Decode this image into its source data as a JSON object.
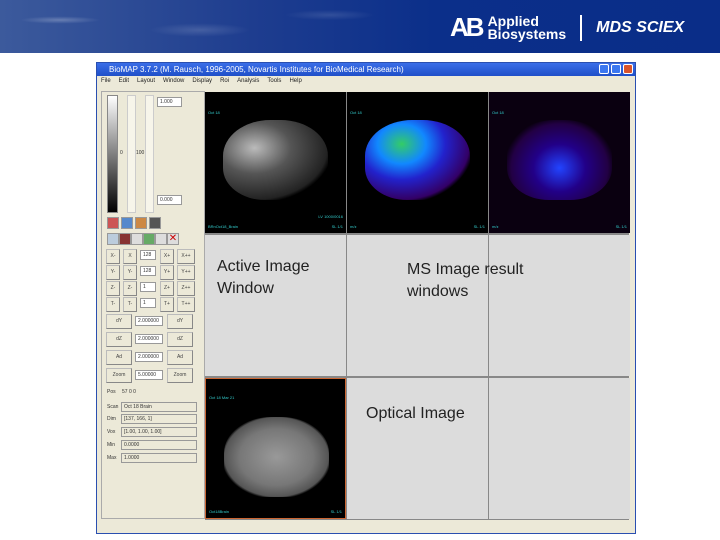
{
  "banner": {
    "logo_text": "AB Applied Biosystems | MDS SCIEX"
  },
  "window": {
    "title": "BioMAP 3.7.2 (M. Rausch, 1996-2005, Novartis Institutes for BioMedical Research)",
    "menu": [
      "File",
      "Edit",
      "Layout",
      "Window",
      "Display",
      "Roi",
      "Analysis",
      "Tools",
      "Help"
    ]
  },
  "left_panel": {
    "max_value": "1.000",
    "min_value": "0.000",
    "slider_left": "0",
    "slider_right": "100",
    "rows": [
      [
        "X-",
        "X",
        "128",
        "X+",
        "X++"
      ],
      [
        "Y-",
        "Y-",
        "128",
        "Y+",
        "Y++"
      ],
      [
        "Z-",
        "Z-",
        "1",
        "Z+",
        "Z++"
      ],
      [
        "T-",
        "T-",
        "1",
        "T+",
        "T++"
      ]
    ],
    "param_rows": [
      [
        "dY",
        "2.000000",
        "dY"
      ],
      [
        "dZ",
        "2.000000",
        "dZ"
      ],
      [
        "Ad",
        "2.000000",
        "Ad"
      ],
      [
        "Zoom",
        "5.00000",
        "Zoom"
      ]
    ],
    "info": [
      {
        "label": "Pos",
        "value": "57  0  0"
      },
      {
        "label": "Scan",
        "value": "Oct 18 Brain"
      },
      {
        "label": "Dim",
        "value": "[137, 166, 1]"
      },
      {
        "label": "Vox",
        "value": "[1.00, 1.00, 1.00]"
      },
      {
        "label": "Min",
        "value": "0.0000"
      },
      {
        "label": "Max",
        "value": "1.0000"
      }
    ]
  },
  "images": [
    {
      "top_label": "Oct 18",
      "bottom_left": "BRnOct18_Brain",
      "bottom_right": "SL 1/1",
      "extra": "LV 1000/0016"
    },
    {
      "top_label": "Oct 18",
      "bottom_left": "m/z",
      "bottom_right": "SL 1/1"
    },
    {
      "top_label": "Oct 18",
      "bottom_left": "m/z",
      "bottom_right": "SL 1/1"
    },
    {
      "top_label": "Oct 18 Mar 21",
      "bottom_left": "Oct18Brain",
      "bottom_right": "SL 1/1"
    }
  ],
  "annotations": {
    "active": "Active Image Window",
    "ms": "MS Image result windows",
    "optical": "Optical Image"
  }
}
